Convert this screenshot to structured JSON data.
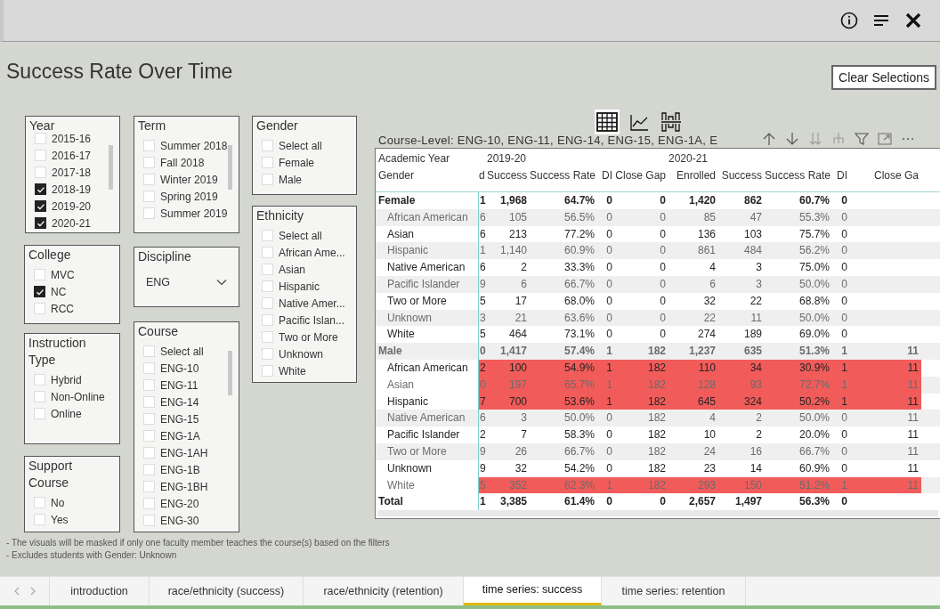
{
  "page_title": "Success Rate Over Time",
  "clear_button": "Clear Selections",
  "visual_switcher": [
    {
      "kind": "table",
      "selected": true
    },
    {
      "kind": "line",
      "selected": false
    },
    {
      "kind": "column",
      "selected": false
    }
  ],
  "filters": [
    {
      "title": "Year",
      "kind": "list",
      "items": [
        {
          "label": "2015-16",
          "checked": false
        },
        {
          "label": "2016-17",
          "checked": false
        },
        {
          "label": "2017-18",
          "checked": false
        },
        {
          "label": "2018-19",
          "checked": true
        },
        {
          "label": "2019-20",
          "checked": true
        },
        {
          "label": "2020-21",
          "checked": true
        }
      ]
    },
    {
      "title": "Term",
      "kind": "list",
      "items": [
        {
          "label": "Summer 2018",
          "checked": false
        },
        {
          "label": "Fall 2018",
          "checked": false
        },
        {
          "label": "Winter 2019",
          "checked": false
        },
        {
          "label": "Spring 2019",
          "checked": false
        },
        {
          "label": "Summer 2019",
          "checked": false
        }
      ]
    },
    {
      "title": "Gender",
      "kind": "list",
      "items": [
        {
          "label": "Select all",
          "checked": false
        },
        {
          "label": "Female",
          "checked": false
        },
        {
          "label": "Male",
          "checked": false
        }
      ]
    },
    {
      "title": "Ethnicity",
      "kind": "list",
      "items": [
        {
          "label": "Select all",
          "checked": false
        },
        {
          "label": "African Ame...",
          "checked": false
        },
        {
          "label": "Asian",
          "checked": false
        },
        {
          "label": "Hispanic",
          "checked": false
        },
        {
          "label": "Native Amer...",
          "checked": false
        },
        {
          "label": "Pacific Islan...",
          "checked": false
        },
        {
          "label": "Two or More",
          "checked": false
        },
        {
          "label": "Unknown",
          "checked": false
        },
        {
          "label": "White",
          "checked": false
        }
      ]
    },
    {
      "title": "College",
      "kind": "list",
      "items": [
        {
          "label": "MVC",
          "checked": false
        },
        {
          "label": "NC",
          "checked": true
        },
        {
          "label": "RCC",
          "checked": false
        }
      ]
    },
    {
      "title": "Discipline",
      "kind": "dropdown",
      "value": "ENG"
    },
    {
      "title": "Course",
      "kind": "list",
      "items": [
        {
          "label": "Select all",
          "checked": false
        },
        {
          "label": "ENG-10",
          "checked": false
        },
        {
          "label": "ENG-11",
          "checked": false
        },
        {
          "label": "ENG-14",
          "checked": false
        },
        {
          "label": "ENG-15",
          "checked": false
        },
        {
          "label": "ENG-1A",
          "checked": false
        },
        {
          "label": "ENG-1AH",
          "checked": false
        },
        {
          "label": "ENG-1B",
          "checked": false
        },
        {
          "label": "ENG-1BH",
          "checked": false
        },
        {
          "label": "ENG-20",
          "checked": false
        },
        {
          "label": "ENG-30",
          "checked": false
        }
      ]
    },
    {
      "title": "Instruction Type",
      "kind": "list",
      "items": [
        {
          "label": "Hybrid",
          "checked": false
        },
        {
          "label": "Non-Online",
          "checked": false
        },
        {
          "label": "Online",
          "checked": false
        }
      ]
    },
    {
      "title": "Support Course",
      "kind": "list",
      "items": [
        {
          "label": "No",
          "checked": false
        },
        {
          "label": "Yes",
          "checked": false
        }
      ]
    }
  ],
  "table": {
    "title": "Course-Level: ENG-10, ENG-11, ENG-14, ENG-15, ENG-1A, E",
    "year_label": "Academic Year",
    "years": [
      "2019-20",
      "2020-21"
    ],
    "columns": [
      "Gender",
      "d",
      "Success",
      "Success Rate",
      "DI",
      "Close Gap",
      "Enrolled",
      "Success",
      "Success Rate",
      "DI",
      "Close Ga"
    ],
    "rows": [
      {
        "kind": "group",
        "highlighted": false,
        "cells": [
          "Female",
          "1",
          "1,968",
          "64.7%",
          "0",
          "0",
          "1,420",
          "862",
          "60.7%",
          "0"
        ]
      },
      {
        "kind": "item",
        "highlighted": false,
        "cells": [
          "African American",
          "6",
          "105",
          "56.5%",
          "0",
          "0",
          "85",
          "47",
          "55.3%",
          "0"
        ]
      },
      {
        "kind": "item",
        "highlighted": false,
        "cells": [
          "Asian",
          "6",
          "213",
          "77.2%",
          "0",
          "0",
          "136",
          "103",
          "75.7%",
          "0"
        ]
      },
      {
        "kind": "item",
        "highlighted": false,
        "cells": [
          "Hispanic",
          "1",
          "1,140",
          "60.9%",
          "0",
          "0",
          "861",
          "484",
          "56.2%",
          "0"
        ]
      },
      {
        "kind": "item",
        "highlighted": false,
        "cells": [
          "Native American",
          "6",
          "2",
          "33.3%",
          "0",
          "0",
          "4",
          "3",
          "75.0%",
          "0"
        ]
      },
      {
        "kind": "item",
        "highlighted": false,
        "cells": [
          "Pacific Islander",
          "9",
          "6",
          "66.7%",
          "0",
          "0",
          "6",
          "3",
          "50.0%",
          "0"
        ]
      },
      {
        "kind": "item",
        "highlighted": false,
        "cells": [
          "Two or More",
          "5",
          "17",
          "68.0%",
          "0",
          "0",
          "32",
          "22",
          "68.8%",
          "0"
        ]
      },
      {
        "kind": "item",
        "highlighted": false,
        "cells": [
          "Unknown",
          "3",
          "21",
          "63.6%",
          "0",
          "0",
          "22",
          "11",
          "50.0%",
          "0"
        ]
      },
      {
        "kind": "item",
        "highlighted": false,
        "cells": [
          "White",
          "5",
          "464",
          "73.1%",
          "0",
          "0",
          "274",
          "189",
          "69.0%",
          "0"
        ]
      },
      {
        "kind": "group",
        "highlighted": false,
        "cells": [
          "Male",
          "0",
          "1,417",
          "57.4%",
          "1",
          "182",
          "1,237",
          "635",
          "51.3%",
          "1",
          "11"
        ]
      },
      {
        "kind": "item",
        "highlighted": true,
        "cells": [
          "African American",
          "2",
          "100",
          "54.9%",
          "1",
          "182",
          "110",
          "34",
          "30.9%",
          "1",
          "11"
        ]
      },
      {
        "kind": "item",
        "highlighted": true,
        "cells": [
          "Asian",
          "0",
          "197",
          "65.7%",
          "1",
          "182",
          "128",
          "93",
          "72.7%",
          "1",
          "11"
        ]
      },
      {
        "kind": "item",
        "highlighted": true,
        "cells": [
          "Hispanic",
          "7",
          "700",
          "53.6%",
          "1",
          "182",
          "645",
          "324",
          "50.2%",
          "1",
          "11"
        ]
      },
      {
        "kind": "item",
        "highlighted": false,
        "cells": [
          "Native American",
          "6",
          "3",
          "50.0%",
          "0",
          "182",
          "4",
          "2",
          "50.0%",
          "0",
          "11"
        ]
      },
      {
        "kind": "item",
        "highlighted": false,
        "cells": [
          "Pacific Islander",
          "2",
          "7",
          "58.3%",
          "0",
          "182",
          "10",
          "2",
          "20.0%",
          "0",
          "11"
        ]
      },
      {
        "kind": "item",
        "highlighted": false,
        "cells": [
          "Two or More",
          "9",
          "26",
          "66.7%",
          "0",
          "182",
          "24",
          "16",
          "66.7%",
          "0",
          "11"
        ]
      },
      {
        "kind": "item",
        "highlighted": false,
        "cells": [
          "Unknown",
          "9",
          "32",
          "54.2%",
          "0",
          "182",
          "23",
          "14",
          "60.9%",
          "0",
          "11"
        ]
      },
      {
        "kind": "item",
        "highlighted": true,
        "cells": [
          "White",
          "5",
          "352",
          "62.3%",
          "1",
          "182",
          "293",
          "150",
          "51.2%",
          "1",
          "11"
        ]
      },
      {
        "kind": "total",
        "highlighted": false,
        "cells": [
          "Total",
          "1",
          "3,385",
          "61.4%",
          "0",
          "0",
          "2,657",
          "1,497",
          "56.3%",
          "0"
        ]
      }
    ]
  },
  "notes": [
    "- The visuals will be masked if only one faculty member teaches the course(s) based on the filters",
    "- Excludes students with Gender: Unknown"
  ],
  "tabs": [
    {
      "label": "introduction",
      "selected": false
    },
    {
      "label": "race/ethnicity (success)",
      "selected": false
    },
    {
      "label": "race/ethnicity (retention)",
      "selected": false
    },
    {
      "label": "time series: success",
      "selected": true
    },
    {
      "label": "time series: retention",
      "selected": false
    }
  ]
}
